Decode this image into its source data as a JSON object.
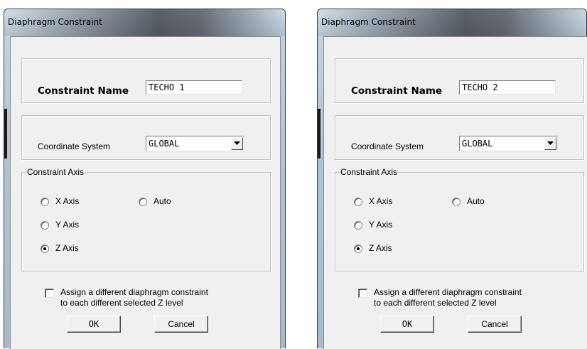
{
  "dialogs": [
    {
      "title": "Diaphragm Constraint",
      "constraint_name_label": "Constraint Name",
      "constraint_name_value": "TECHO 1",
      "coordinate_system_label": "Coordinate System",
      "coordinate_system_value": "GLOBAL",
      "axis_group_label": "Constraint Axis",
      "axes": {
        "x": "X Axis",
        "y": "Y Axis",
        "z": "Z Axis",
        "auto": "Auto"
      },
      "selected_axis": "Z Axis",
      "assign_line1": "Assign a different diaphragm constraint",
      "assign_line2": "to each different selected Z level",
      "assign_checked": false,
      "ok_label": "OK",
      "cancel_label": "Cancel"
    },
    {
      "title": "Diaphragm Constraint",
      "constraint_name_label": "Constraint Name",
      "constraint_name_value": "TECHO 2",
      "coordinate_system_label": "Coordinate System",
      "coordinate_system_value": "GLOBAL",
      "axis_group_label": "Constraint Axis",
      "axes": {
        "x": "X Axis",
        "y": "Y Axis",
        "z": "Z Axis",
        "auto": "Auto"
      },
      "selected_axis": "Z Axis",
      "assign_line1": "Assign a different diaphragm constraint",
      "assign_line2": "to each different selected Z level",
      "assign_checked": false,
      "ok_label": "OK",
      "cancel_label": "Cancel"
    }
  ],
  "icons": {
    "dropdown": "chevron-down-icon"
  }
}
